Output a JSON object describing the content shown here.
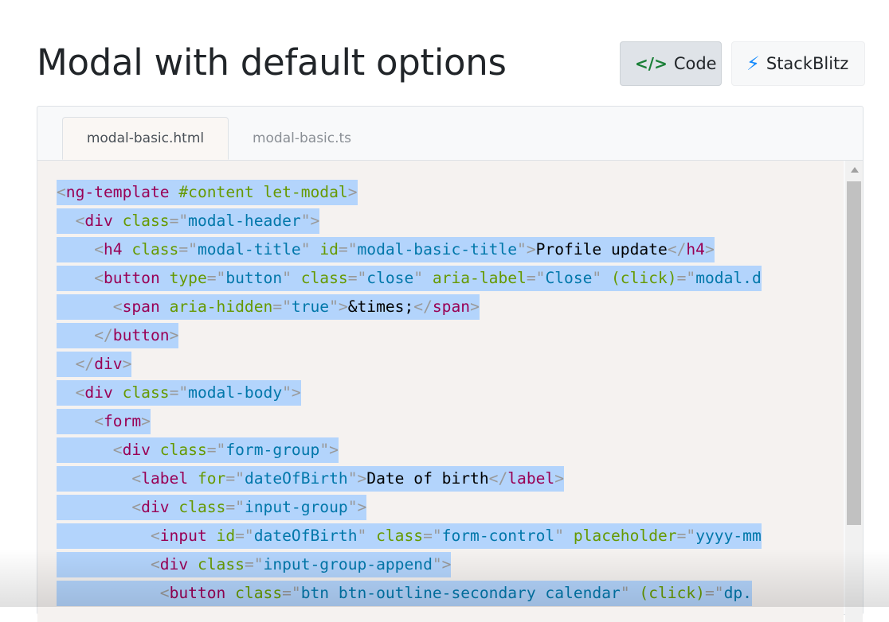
{
  "page": {
    "title": "Modal with default options"
  },
  "actions": {
    "code_label": "Code",
    "stackblitz_label": "StackBlitz"
  },
  "tabs": [
    "modal-basic.html",
    "modal-basic.ts"
  ],
  "code_lines": [
    [
      [
        "p",
        "<"
      ],
      [
        "g",
        "ng-template "
      ],
      [
        "a",
        "#content let-modal"
      ],
      [
        "p",
        ">"
      ]
    ],
    [
      [
        "s",
        "  "
      ],
      [
        "p",
        "<"
      ],
      [
        "g",
        "div "
      ],
      [
        "a",
        "class"
      ],
      [
        "p",
        "=\""
      ],
      [
        "v",
        "modal-header"
      ],
      [
        "p",
        "\">"
      ]
    ],
    [
      [
        "s",
        "    "
      ],
      [
        "p",
        "<"
      ],
      [
        "g",
        "h4 "
      ],
      [
        "a",
        "class"
      ],
      [
        "p",
        "=\""
      ],
      [
        "v",
        "modal-title"
      ],
      [
        "p",
        "\" "
      ],
      [
        "a",
        "id"
      ],
      [
        "p",
        "=\""
      ],
      [
        "v",
        "modal-basic-title"
      ],
      [
        "p",
        "\">"
      ],
      [
        "t",
        "Profile update"
      ],
      [
        "p",
        "</"
      ],
      [
        "g",
        "h4"
      ],
      [
        "p",
        ">"
      ]
    ],
    [
      [
        "s",
        "    "
      ],
      [
        "p",
        "<"
      ],
      [
        "g",
        "button "
      ],
      [
        "a",
        "type"
      ],
      [
        "p",
        "=\""
      ],
      [
        "v",
        "button"
      ],
      [
        "p",
        "\" "
      ],
      [
        "a",
        "class"
      ],
      [
        "p",
        "=\""
      ],
      [
        "v",
        "close"
      ],
      [
        "p",
        "\" "
      ],
      [
        "a",
        "aria-label"
      ],
      [
        "p",
        "=\""
      ],
      [
        "v",
        "Close"
      ],
      [
        "p",
        "\" "
      ],
      [
        "a",
        "(click)"
      ],
      [
        "p",
        "=\""
      ],
      [
        "v",
        "modal.d"
      ]
    ],
    [
      [
        "s",
        "      "
      ],
      [
        "p",
        "<"
      ],
      [
        "g",
        "span "
      ],
      [
        "a",
        "aria-hidden"
      ],
      [
        "p",
        "=\""
      ],
      [
        "v",
        "true"
      ],
      [
        "p",
        "\">"
      ],
      [
        "t",
        "&times;"
      ],
      [
        "p",
        "</"
      ],
      [
        "g",
        "span"
      ],
      [
        "p",
        ">"
      ]
    ],
    [
      [
        "s",
        "    "
      ],
      [
        "p",
        "</"
      ],
      [
        "g",
        "button"
      ],
      [
        "p",
        ">"
      ]
    ],
    [
      [
        "s",
        "  "
      ],
      [
        "p",
        "</"
      ],
      [
        "g",
        "div"
      ],
      [
        "p",
        ">"
      ]
    ],
    [
      [
        "s",
        "  "
      ],
      [
        "p",
        "<"
      ],
      [
        "g",
        "div "
      ],
      [
        "a",
        "class"
      ],
      [
        "p",
        "=\""
      ],
      [
        "v",
        "modal-body"
      ],
      [
        "p",
        "\">"
      ]
    ],
    [
      [
        "s",
        "    "
      ],
      [
        "p",
        "<"
      ],
      [
        "g",
        "form"
      ],
      [
        "p",
        ">"
      ]
    ],
    [
      [
        "s",
        "      "
      ],
      [
        "p",
        "<"
      ],
      [
        "g",
        "div "
      ],
      [
        "a",
        "class"
      ],
      [
        "p",
        "=\""
      ],
      [
        "v",
        "form-group"
      ],
      [
        "p",
        "\">"
      ]
    ],
    [
      [
        "s",
        "        "
      ],
      [
        "p",
        "<"
      ],
      [
        "g",
        "label "
      ],
      [
        "a",
        "for"
      ],
      [
        "p",
        "=\""
      ],
      [
        "v",
        "dateOfBirth"
      ],
      [
        "p",
        "\">"
      ],
      [
        "t",
        "Date of birth"
      ],
      [
        "p",
        "</"
      ],
      [
        "g",
        "label"
      ],
      [
        "p",
        ">"
      ]
    ],
    [
      [
        "s",
        "        "
      ],
      [
        "p",
        "<"
      ],
      [
        "g",
        "div "
      ],
      [
        "a",
        "class"
      ],
      [
        "p",
        "=\""
      ],
      [
        "v",
        "input-group"
      ],
      [
        "p",
        "\">"
      ]
    ],
    [
      [
        "s",
        "          "
      ],
      [
        "p",
        "<"
      ],
      [
        "g",
        "input "
      ],
      [
        "a",
        "id"
      ],
      [
        "p",
        "=\""
      ],
      [
        "v",
        "dateOfBirth"
      ],
      [
        "p",
        "\" "
      ],
      [
        "a",
        "class"
      ],
      [
        "p",
        "=\""
      ],
      [
        "v",
        "form-control"
      ],
      [
        "p",
        "\" "
      ],
      [
        "a",
        "placeholder"
      ],
      [
        "p",
        "=\""
      ],
      [
        "v",
        "yyyy-mm"
      ]
    ],
    [
      [
        "s",
        "          "
      ],
      [
        "p",
        "<"
      ],
      [
        "g",
        "div "
      ],
      [
        "a",
        "class"
      ],
      [
        "p",
        "=\""
      ],
      [
        "v",
        "input-group-append"
      ],
      [
        "p",
        "\">"
      ]
    ],
    [
      [
        "s",
        "           "
      ],
      [
        "p",
        "<"
      ],
      [
        "g",
        "button "
      ],
      [
        "a",
        "class"
      ],
      [
        "p",
        "=\""
      ],
      [
        "v",
        "btn btn-outline-secondary calendar"
      ],
      [
        "p",
        "\" "
      ],
      [
        "a",
        "(click)"
      ],
      [
        "p",
        "=\""
      ],
      [
        "v",
        "dp."
      ]
    ]
  ]
}
